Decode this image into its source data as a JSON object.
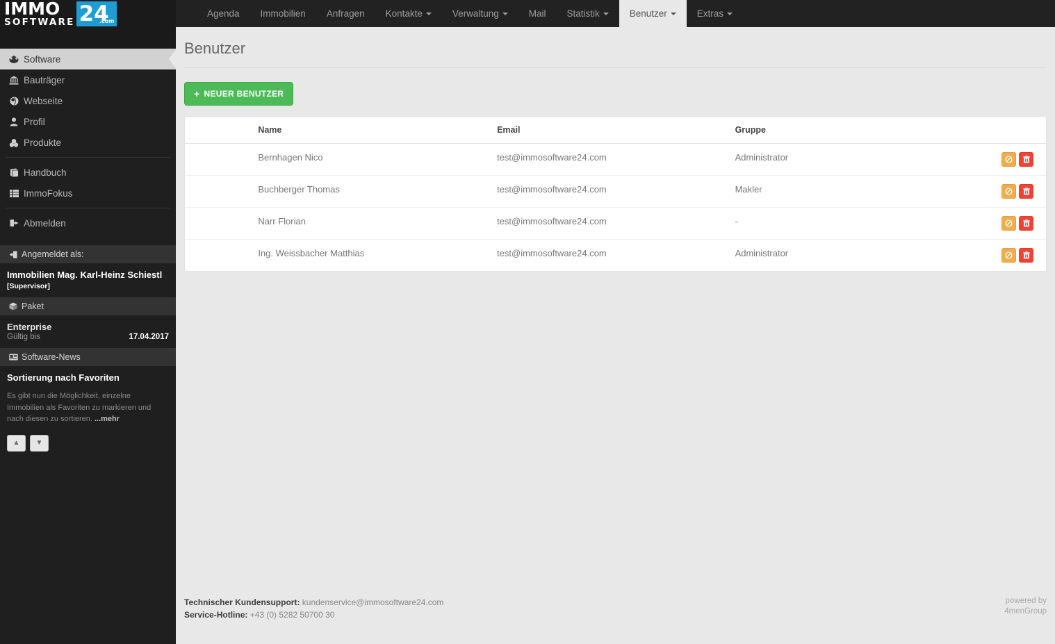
{
  "brand": {
    "immo": "IMMO",
    "software": "SOFTWARE",
    "twentyfour": "24",
    "com": ".com",
    "accent_color": "#1f9cd4"
  },
  "topnav": {
    "items": [
      {
        "label": "Agenda",
        "caret": false,
        "active": false
      },
      {
        "label": "Immobilien",
        "caret": false,
        "active": false
      },
      {
        "label": "Anfragen",
        "caret": false,
        "active": false
      },
      {
        "label": "Kontakte",
        "caret": true,
        "active": false
      },
      {
        "label": "Verwaltung",
        "caret": true,
        "active": false
      },
      {
        "label": "Mail",
        "caret": false,
        "active": false
      },
      {
        "label": "Statistik",
        "caret": true,
        "active": false
      },
      {
        "label": "Benutzer",
        "caret": true,
        "active": true
      },
      {
        "label": "Extras",
        "caret": true,
        "active": false
      }
    ]
  },
  "sidebar": {
    "items": [
      {
        "label": "Software",
        "icon": "dashboard-icon",
        "glyph": "⚛",
        "active": true
      },
      {
        "label": "Bauträger",
        "icon": "bank-icon",
        "glyph": "ἽB",
        "active": false
      },
      {
        "label": "Webseite",
        "icon": "globe-icon",
        "glyph": "◔",
        "active": false
      },
      {
        "label": "Profil",
        "icon": "user-icon",
        "glyph": "♟",
        "active": false
      },
      {
        "label": "Produkte",
        "icon": "cubes-icon",
        "glyph": "⬢",
        "active": false
      }
    ],
    "items2": [
      {
        "label": "Handbuch",
        "icon": "book-icon",
        "glyph": "▤",
        "active": false
      },
      {
        "label": "ImmoFokus",
        "icon": "list-icon",
        "glyph": "☰",
        "active": false
      }
    ],
    "items3": [
      {
        "label": "Abmelden",
        "icon": "signout-icon",
        "glyph": "➡",
        "active": false
      }
    ],
    "loggedin": {
      "header": "Angemeldet als:",
      "header_icon": "signin-icon",
      "name": "Immobilien Mag. Karl-Heinz Schiestl",
      "role": "[Supervisor]"
    },
    "paket": {
      "header": "Paket",
      "header_icon": "cube-icon",
      "name": "Enterprise",
      "valid_label": "Gültig bis",
      "valid_date": "17.04.2017"
    },
    "news": {
      "header": "Software-News",
      "header_icon": "newspaper-icon",
      "title": "Sortierung nach Favoriten",
      "text": "Es gibt nun die Möglichkeit, einzelne Immobilien als Favoriten zu markieren und nach diesen zu sortieren. ",
      "more": "...mehr",
      "prev_icon": "chevron-up-icon",
      "next_icon": "chevron-down-icon"
    }
  },
  "page": {
    "title": "Benutzer",
    "new_button": "NEUER BENUTZER",
    "new_button_plus": "+"
  },
  "table": {
    "columns": [
      "",
      "Name",
      "Email",
      "Gruppe",
      ""
    ],
    "rows": [
      {
        "name": "Bernhagen Nico",
        "email": "test@immosoftware24.com",
        "group": "Administrator"
      },
      {
        "name": "Buchberger Thomas",
        "email": "test@immosoftware24.com",
        "group": "Makler"
      },
      {
        "name": "Narr Florian",
        "email": "test@immosoftware24.com",
        "group": "-"
      },
      {
        "name": "Ing. Weissbacher Matthias",
        "email": "test@immosoftware24.com",
        "group": "Administrator"
      }
    ],
    "action_ban_icon": "ban-icon",
    "action_delete_icon": "trash-icon"
  },
  "footer": {
    "support_label": "Technischer Kundensupport:",
    "support_email": " kundenservice@immosoftware24.com",
    "hotline_label": "Service-Hotline:",
    "hotline_value": " +43 (0) 5282 50700 30",
    "powered_label": "powered by",
    "powered_name": "4menGroup"
  }
}
